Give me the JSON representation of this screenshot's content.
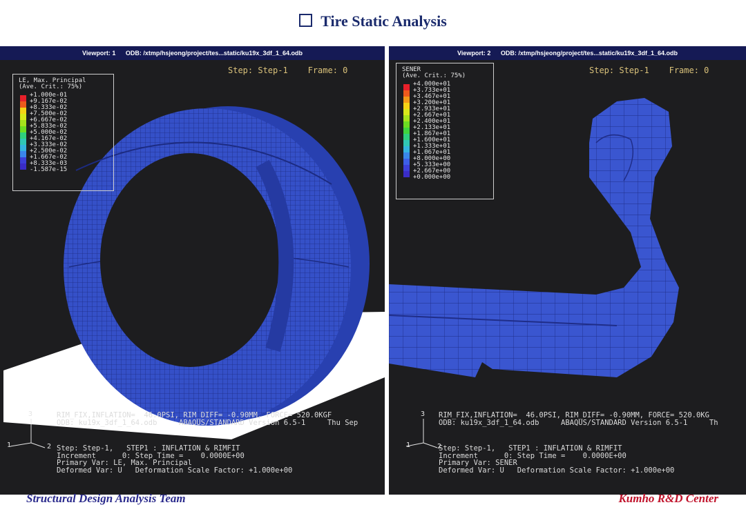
{
  "slide": {
    "title": "Tire Static Analysis",
    "footer_left": "Structural Design Analysis Team",
    "footer_right": "Kumho R&D Center"
  },
  "viewports": [
    {
      "header_viewport": "Viewport: 1",
      "header_odb": "ODB: /xtmp/hsjeong/project/tes...static/ku19x_3df_1_64.odb",
      "step_line": "Step: Step-1    Frame: 0",
      "legend_title": "LE, Max. Principal\n(Ave. Crit.: 75%)",
      "legend_values": [
        "+1.000e-01",
        "+9.167e-02",
        "+8.333e-02",
        "+7.500e-02",
        "+6.667e-02",
        "+5.833e-02",
        "+5.000e-02",
        "+4.167e-02",
        "+3.333e-02",
        "+2.500e-02",
        "+1.667e-02",
        "+8.333e-03",
        "-1.587e-15"
      ],
      "info_line1": "RIM_FIX,INFLATION=  46.0PSI, RIM_DIFF= -0.90MM, FORCE= 520.0KGF",
      "info_line2": "ODB: ku19x_3df_1_64.odb     ABAQUS/STANDARD Version 6.5-1     Thu Sep",
      "status_lines": "Step: Step-1,   STEP1 : INFLATION & RIMFIT\nIncrement      0: Step Time =    0.0000E+00\nPrimary Var: LE, Max. Principal\nDeformed Var: U   Deformation Scale Factor: +1.000e+00",
      "axis_3": "3",
      "axis_1": "1",
      "axis_2": "2"
    },
    {
      "header_viewport": "Viewport: 2",
      "header_odb": "ODB: /xtmp/hsjeong/project/tes...static/ku19x_3df_1_64.odb",
      "step_line": "Step: Step-1    Frame: 0",
      "legend_title": "SENER\n(Ave. Crit.: 75%)",
      "legend_values": [
        "+4.000e+01",
        "+3.733e+01",
        "+3.467e+01",
        "+3.200e+01",
        "+2.933e+01",
        "+2.667e+01",
        "+2.400e+01",
        "+2.133e+01",
        "+1.867e+01",
        "+1.600e+01",
        "+1.333e+01",
        "+1.067e+01",
        "+8.000e+00",
        "+5.333e+00",
        "+2.667e+00",
        "+0.000e+00"
      ],
      "info_line1": "RIM_FIX,INFLATION=  46.0PSI, RIM_DIFF= -0.90MM, FORCE= 520.0KG",
      "info_line2": "ODB: ku19x_3df_1_64.odb     ABAQUS/STANDARD Version 6.5-1     Th",
      "status_lines": "Step: Step-1,   STEP1 : INFLATION & RIMFIT\nIncrement      0: Step Time =    0.0000E+00\nPrimary Var: SENER\nDeformed Var: U   Deformation Scale Factor: +1.000e+00",
      "axis_3": "3",
      "axis_1": "1",
      "axis_2": "2"
    }
  ],
  "colors": {
    "title": "#1a2a6c",
    "footer": "#2a2a8c",
    "mesh_blue": "#3550c8",
    "viewport_bg": "#1d1d1f",
    "header_bar": "#151a55",
    "step_text": "#d9c17a",
    "legend_scale": [
      "#e8202a",
      "#ee5a1c",
      "#f29a18",
      "#f5d315",
      "#d8e81a",
      "#a6e31c",
      "#6cdc22",
      "#3fd43d",
      "#2fcf7d",
      "#30c6b5",
      "#34b3e0",
      "#3a86ea",
      "#3d5ee6",
      "#3c3fd8",
      "#3a2cc7",
      "#3a22b5"
    ]
  }
}
